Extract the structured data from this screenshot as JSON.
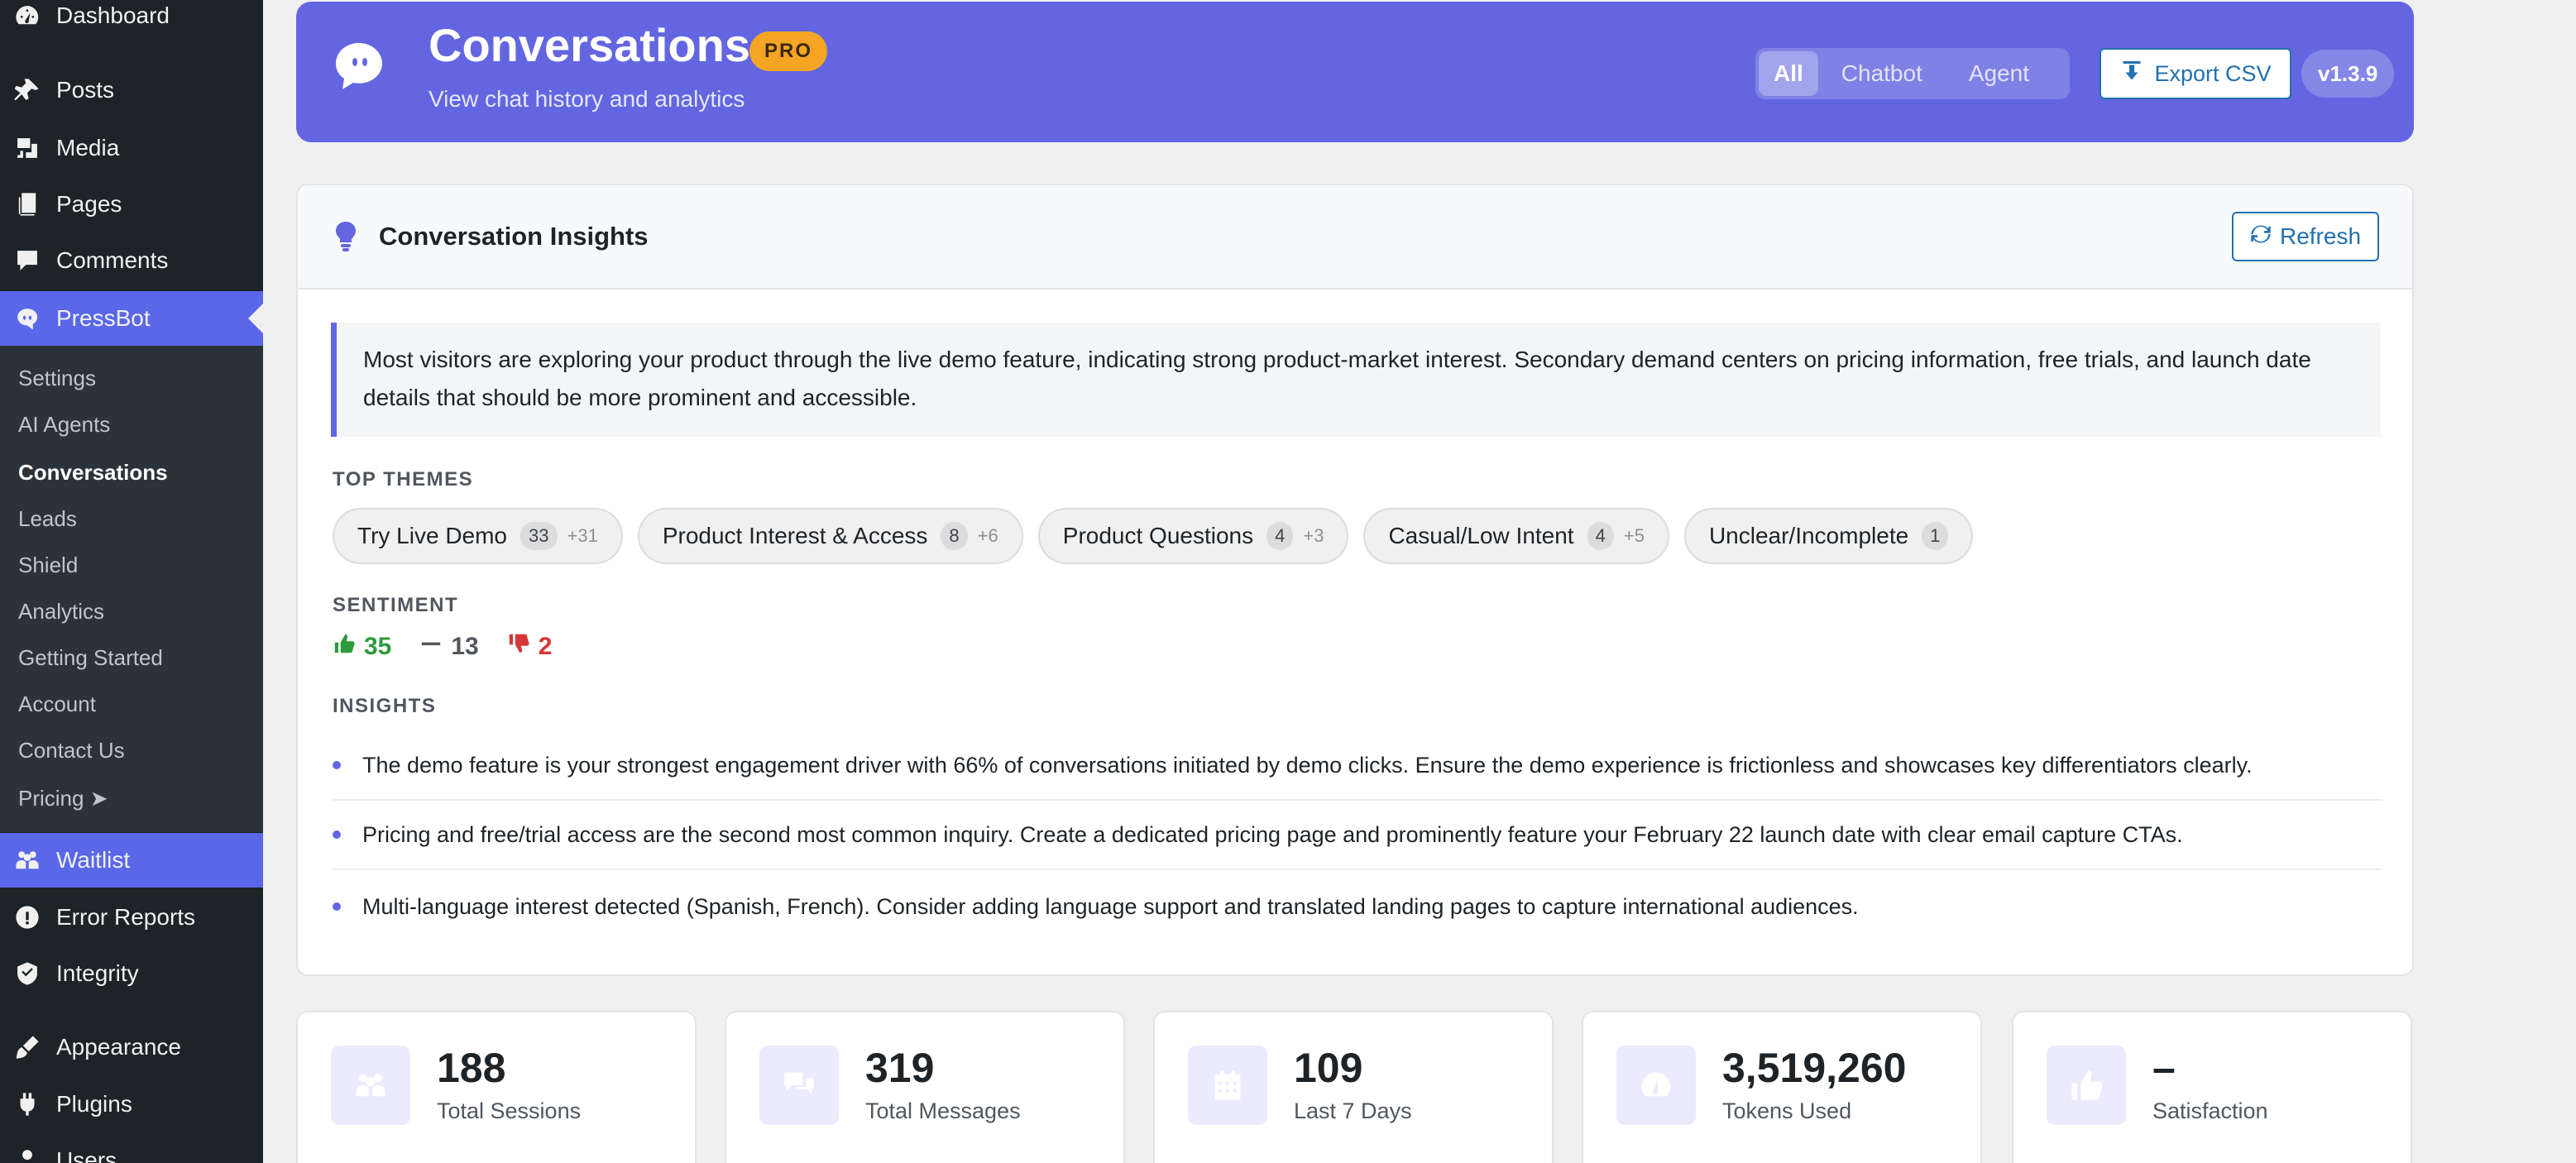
{
  "sidebar": {
    "top_items": [
      {
        "label": "Dashboard",
        "icon": "dashboard-icon"
      },
      {
        "label": "Posts",
        "icon": "pin-icon"
      },
      {
        "label": "Media",
        "icon": "media-icon"
      },
      {
        "label": "Pages",
        "icon": "pages-icon"
      },
      {
        "label": "Comments",
        "icon": "comment-icon"
      },
      {
        "label": "PressBot",
        "icon": "chat-bubble-icon"
      }
    ],
    "submenu": [
      "Settings",
      "AI Agents",
      "Conversations",
      "Leads",
      "Shield",
      "Analytics",
      "Getting Started",
      "Account",
      "Contact Us",
      "Pricing ➤"
    ],
    "bottom_items": [
      {
        "label": "Waitlist",
        "icon": "group-icon"
      },
      {
        "label": "Error Reports",
        "icon": "warning-icon"
      },
      {
        "label": "Integrity",
        "icon": "shield-icon"
      },
      {
        "label": "Appearance",
        "icon": "brush-icon"
      },
      {
        "label": "Plugins",
        "icon": "plugin-icon"
      },
      {
        "label": "Users",
        "icon": "user-icon"
      }
    ]
  },
  "header": {
    "title": "Conversations",
    "badge": "PRO",
    "subtitle": "View chat history and analytics",
    "filters": [
      "All",
      "Chatbot",
      "Agent"
    ],
    "active_filter": "All",
    "export_label": "Export CSV",
    "version": "v1.3.9"
  },
  "insights": {
    "title": "Conversation Insights",
    "refresh_label": "Refresh",
    "summary": "Most visitors are exploring your product through the live demo feature, indicating strong product-market interest. Secondary demand centers on pricing information, free trials, and launch date details that should be more prominent and accessible.",
    "themes_label": "TOP THEMES",
    "themes": [
      {
        "name": "Try Live Demo",
        "count": "33",
        "delta": "+31"
      },
      {
        "name": "Product Interest & Access",
        "count": "8",
        "delta": "+6"
      },
      {
        "name": "Product Questions",
        "count": "4",
        "delta": "+3"
      },
      {
        "name": "Casual/Low Intent",
        "count": "4",
        "delta": "+5"
      },
      {
        "name": "Unclear/Incomplete",
        "count": "1",
        "delta": ""
      }
    ],
    "sentiment_label": "SENTIMENT",
    "sentiment": {
      "positive": "35",
      "neutral": "13",
      "negative": "2"
    },
    "insights_label": "INSIGHTS",
    "items": [
      "The demo feature is your strongest engagement driver with 66% of conversations initiated by demo clicks. Ensure the demo experience is frictionless and showcases key differentiators clearly.",
      "Pricing and free/trial access are the second most common inquiry. Create a dedicated pricing page and prominently feature your February 22 launch date with clear email capture CTAs.",
      "Multi-language interest detected (Spanish, French). Consider adding language support and translated landing pages to capture international audiences."
    ]
  },
  "stats": [
    {
      "value": "188",
      "label": "Total Sessions",
      "icon": "users-icon"
    },
    {
      "value": "319",
      "label": "Total Messages",
      "icon": "messages-icon"
    },
    {
      "value": "109",
      "label": "Last 7 Days",
      "icon": "calendar-icon"
    },
    {
      "value": "3,519,260",
      "label": "Tokens Used",
      "icon": "gauge-icon"
    },
    {
      "value": "–",
      "label": "Satisfaction",
      "icon": "thumbs-up-icon"
    }
  ],
  "colors": {
    "accent": "#6366e0",
    "wp_blue": "#2271b1",
    "pro": "#f5a524",
    "positive": "#2f9a3c",
    "negative": "#d63638"
  }
}
